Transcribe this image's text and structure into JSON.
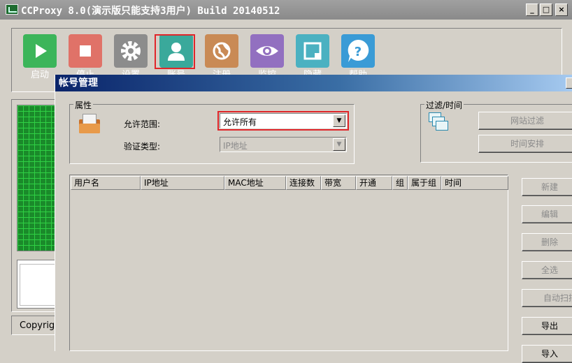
{
  "window": {
    "title": "CCProxy 8.0(演示版只能支持3用户) Build 20140512",
    "min_glyph": "_",
    "max_glyph": "□",
    "close_glyph": "×"
  },
  "toolbar": {
    "buttons": [
      {
        "label": "启动",
        "icon": "play-icon",
        "color": "#3cb55a"
      },
      {
        "label": "停止",
        "icon": "stop-icon",
        "color": "#e07268"
      },
      {
        "label": "设置",
        "icon": "gear-icon",
        "color": "#8c8c8c"
      },
      {
        "label": "账号",
        "icon": "user-icon",
        "color": "#3aa99b"
      },
      {
        "label": "注册",
        "icon": "globe-icon",
        "color": "#c98a55"
      },
      {
        "label": "监控",
        "icon": "eye-icon",
        "color": "#9270c0"
      },
      {
        "label": "隐藏",
        "icon": "window-icon",
        "color": "#4bb1c1"
      },
      {
        "label": "帮助",
        "icon": "help-icon",
        "color": "#3a9bd6"
      }
    ],
    "highlight_color": "#e0262a"
  },
  "left": {
    "copyright": "Copyright"
  },
  "dialog": {
    "title": "帐号管理",
    "attributes_group": "属性",
    "allow_range_label": "允许范围:",
    "allow_range_value": "允许所有",
    "auth_type_label": "验证类型:",
    "auth_type_value": "IP地址",
    "filter_group": "过滤/时间",
    "site_filter": "网站过滤",
    "time_schedule": "时间安排",
    "columns": [
      "用户名",
      "IP地址",
      "MAC地址",
      "连接数",
      "带宽",
      "开通",
      "组",
      "属于组",
      "时间"
    ],
    "buttons": {
      "new": "新建",
      "edit": "编辑",
      "delete": "删除",
      "select_all": "全选",
      "auto_scan": "自动扫描",
      "export": "导出",
      "import": "导入"
    }
  }
}
